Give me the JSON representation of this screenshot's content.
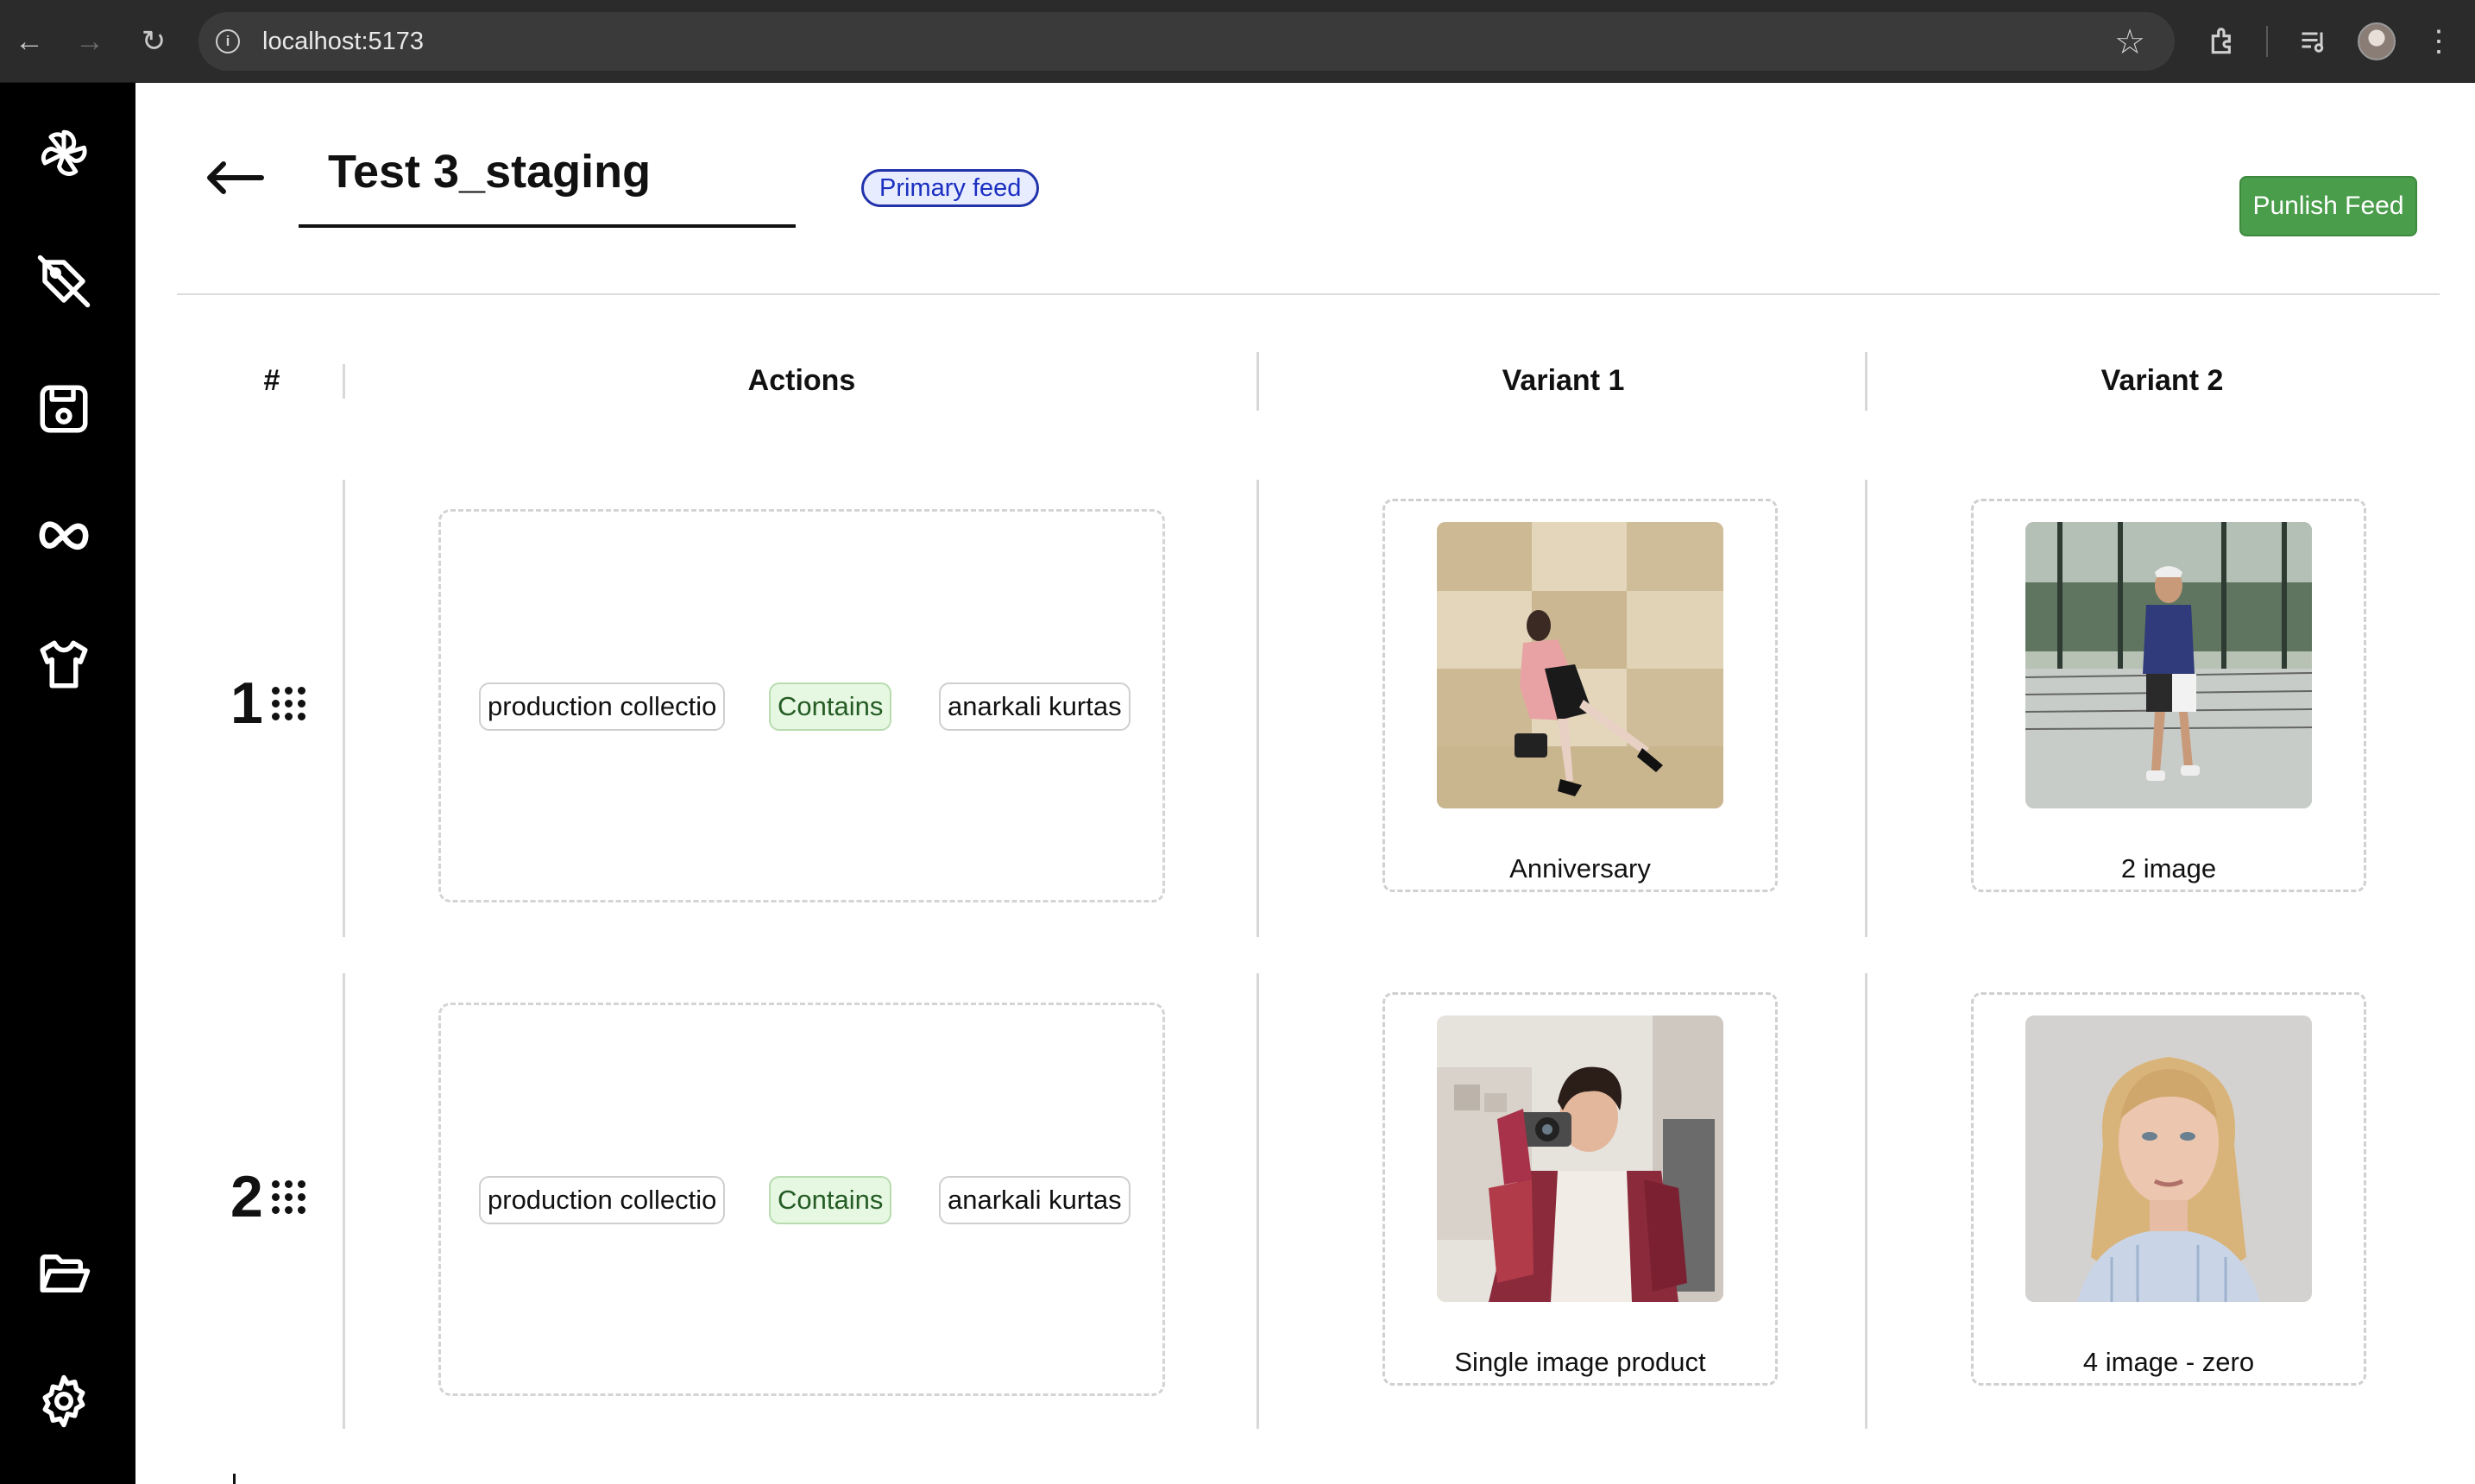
{
  "browser": {
    "url": "localhost:5173"
  },
  "page": {
    "title": "Test 3_staging",
    "badge": "Primary feed",
    "publish_label": "Punlish Feed"
  },
  "table": {
    "headers": [
      "#",
      "Actions",
      "Variant 1",
      "Variant 2"
    ],
    "rows": [
      {
        "number": "1",
        "action": {
          "field": "production collectio",
          "operator": "Contains",
          "value": "anarkali kurtas"
        },
        "variants": [
          {
            "label": "Anniversary",
            "image": "woman-pink-coat-photo"
          },
          {
            "label": "2 image",
            "image": "man-tennis-court-photo"
          }
        ]
      },
      {
        "number": "2",
        "action": {
          "field": "production collectio",
          "operator": "Contains",
          "value": "anarkali kurtas"
        },
        "variants": [
          {
            "label": "Single image product",
            "image": "man-camera-photo"
          },
          {
            "label": "4 image - zero",
            "image": "blonde-woman-portrait-photo"
          }
        ]
      }
    ]
  },
  "colors": {
    "sidebar": "#000000",
    "publish_button": "#4a9d4b",
    "badge_border": "#2233aa",
    "operator_chip": "#e6f7e2"
  }
}
